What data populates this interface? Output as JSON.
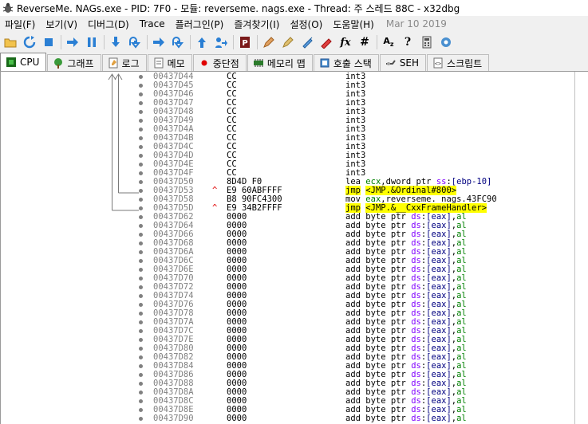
{
  "window": {
    "title": "ReverseMe. NAGs.exe - PID: 7F0 - 모듈: reverseme. nags.exe - Thread: 주 스레드 88C - x32dbg"
  },
  "menu": {
    "items": [
      "파일(F)",
      "보기(V)",
      "디버그(D)",
      "Trace",
      "플러그인(P)",
      "즐겨찾기(I)",
      "설정(O)",
      "도움말(H)"
    ],
    "date": "Mar 10 2019"
  },
  "toolbar": {
    "icons": [
      "open-folder-icon",
      "restart-icon",
      "stop-icon",
      "run-icon",
      "pause-icon",
      "step-into-icon",
      "step-over-icon",
      "trace-into-icon",
      "trace-over-icon",
      "execute-till-return-icon",
      "run-to-user-code-icon",
      "patch-icon",
      "comment-icon",
      "label-icon",
      "bookmark-icon",
      "function-icon",
      "fx-icon",
      "hash-icon",
      "font-size-icon",
      "help-icon",
      "calculator-icon",
      "settings-icon"
    ]
  },
  "tabs": [
    {
      "label": "CPU",
      "icon": "cpu-icon",
      "active": true
    },
    {
      "label": "그래프",
      "icon": "graph-icon",
      "active": false
    },
    {
      "label": "로그",
      "icon": "log-icon",
      "active": false
    },
    {
      "label": "메모",
      "icon": "notes-icon",
      "active": false
    },
    {
      "label": "중단점",
      "icon": "breakpoint-icon",
      "active": false
    },
    {
      "label": "메모리 맵",
      "icon": "memory-map-icon",
      "active": false
    },
    {
      "label": "호출 스택",
      "icon": "call-stack-icon",
      "active": false
    },
    {
      "label": "SEH",
      "icon": "seh-icon",
      "active": false
    },
    {
      "label": "스크립트",
      "icon": "script-icon",
      "active": false
    }
  ],
  "disasm": [
    {
      "addr": "00437D44",
      "arrow": "",
      "bytes": "CC",
      "dis": [
        {
          "t": "int3",
          "c": "plain"
        }
      ]
    },
    {
      "addr": "00437D45",
      "arrow": "",
      "bytes": "CC",
      "dis": [
        {
          "t": "int3",
          "c": "plain"
        }
      ]
    },
    {
      "addr": "00437D46",
      "arrow": "",
      "bytes": "CC",
      "dis": [
        {
          "t": "int3",
          "c": "plain"
        }
      ]
    },
    {
      "addr": "00437D47",
      "arrow": "",
      "bytes": "CC",
      "dis": [
        {
          "t": "int3",
          "c": "plain"
        }
      ]
    },
    {
      "addr": "00437D48",
      "arrow": "",
      "bytes": "CC",
      "dis": [
        {
          "t": "int3",
          "c": "plain"
        }
      ]
    },
    {
      "addr": "00437D49",
      "arrow": "",
      "bytes": "CC",
      "dis": [
        {
          "t": "int3",
          "c": "plain"
        }
      ]
    },
    {
      "addr": "00437D4A",
      "arrow": "",
      "bytes": "CC",
      "dis": [
        {
          "t": "int3",
          "c": "plain"
        }
      ]
    },
    {
      "addr": "00437D4B",
      "arrow": "",
      "bytes": "CC",
      "dis": [
        {
          "t": "int3",
          "c": "plain"
        }
      ]
    },
    {
      "addr": "00437D4C",
      "arrow": "",
      "bytes": "CC",
      "dis": [
        {
          "t": "int3",
          "c": "plain"
        }
      ]
    },
    {
      "addr": "00437D4D",
      "arrow": "",
      "bytes": "CC",
      "dis": [
        {
          "t": "int3",
          "c": "plain"
        }
      ]
    },
    {
      "addr": "00437D4E",
      "arrow": "",
      "bytes": "CC",
      "dis": [
        {
          "t": "int3",
          "c": "plain"
        }
      ]
    },
    {
      "addr": "00437D4F",
      "arrow": "",
      "bytes": "CC",
      "dis": [
        {
          "t": "int3",
          "c": "plain"
        }
      ]
    },
    {
      "addr": "00437D50",
      "arrow": "",
      "bytes": "8D4D F0",
      "dis": [
        {
          "t": "lea ",
          "c": "plain"
        },
        {
          "t": "ecx",
          "c": "reg"
        },
        {
          "t": ",dword ptr ",
          "c": "plain"
        },
        {
          "t": "ss",
          "c": "seg"
        },
        {
          "t": ":",
          "c": "plain"
        },
        {
          "t": "[ebp-10]",
          "c": "memref"
        }
      ]
    },
    {
      "addr": "00437D53",
      "arrow": "^",
      "bytes": "E9 60ABFFFF",
      "dis": [
        {
          "t": "jmp",
          "c": "jmp"
        },
        {
          "t": " ",
          "c": "plain"
        },
        {
          "t": "<JMP.&Ordinal#800>",
          "c": "jmp"
        }
      ]
    },
    {
      "addr": "00437D58",
      "arrow": "",
      "bytes": "B8 90FC4300",
      "dis": [
        {
          "t": "mov ",
          "c": "plain"
        },
        {
          "t": "eax",
          "c": "reg"
        },
        {
          "t": ",reverseme. nags.43FC90",
          "c": "plain"
        }
      ]
    },
    {
      "addr": "00437D5D",
      "arrow": "^",
      "bytes": "E9 34B2FFFF",
      "dis": [
        {
          "t": "jmp",
          "c": "jmp"
        },
        {
          "t": " ",
          "c": "plain"
        },
        {
          "t": "<JMP.&__CxxFrameHandler>",
          "c": "jmp"
        }
      ]
    },
    {
      "addr": "00437D62",
      "arrow": "",
      "bytes": "0000",
      "dis": "ADD"
    },
    {
      "addr": "00437D64",
      "arrow": "",
      "bytes": "0000",
      "dis": "ADD"
    },
    {
      "addr": "00437D66",
      "arrow": "",
      "bytes": "0000",
      "dis": "ADD"
    },
    {
      "addr": "00437D68",
      "arrow": "",
      "bytes": "0000",
      "dis": "ADD"
    },
    {
      "addr": "00437D6A",
      "arrow": "",
      "bytes": "0000",
      "dis": "ADD"
    },
    {
      "addr": "00437D6C",
      "arrow": "",
      "bytes": "0000",
      "dis": "ADD"
    },
    {
      "addr": "00437D6E",
      "arrow": "",
      "bytes": "0000",
      "dis": "ADD"
    },
    {
      "addr": "00437D70",
      "arrow": "",
      "bytes": "0000",
      "dis": "ADD"
    },
    {
      "addr": "00437D72",
      "arrow": "",
      "bytes": "0000",
      "dis": "ADD"
    },
    {
      "addr": "00437D74",
      "arrow": "",
      "bytes": "0000",
      "dis": "ADD"
    },
    {
      "addr": "00437D76",
      "arrow": "",
      "bytes": "0000",
      "dis": "ADD"
    },
    {
      "addr": "00437D78",
      "arrow": "",
      "bytes": "0000",
      "dis": "ADD"
    },
    {
      "addr": "00437D7A",
      "arrow": "",
      "bytes": "0000",
      "dis": "ADD"
    },
    {
      "addr": "00437D7C",
      "arrow": "",
      "bytes": "0000",
      "dis": "ADD"
    },
    {
      "addr": "00437D7E",
      "arrow": "",
      "bytes": "0000",
      "dis": "ADD"
    },
    {
      "addr": "00437D80",
      "arrow": "",
      "bytes": "0000",
      "dis": "ADD"
    },
    {
      "addr": "00437D82",
      "arrow": "",
      "bytes": "0000",
      "dis": "ADD"
    },
    {
      "addr": "00437D84",
      "arrow": "",
      "bytes": "0000",
      "dis": "ADD"
    },
    {
      "addr": "00437D86",
      "arrow": "",
      "bytes": "0000",
      "dis": "ADD"
    },
    {
      "addr": "00437D88",
      "arrow": "",
      "bytes": "0000",
      "dis": "ADD"
    },
    {
      "addr": "00437D8A",
      "arrow": "",
      "bytes": "0000",
      "dis": "ADD"
    },
    {
      "addr": "00437D8C",
      "arrow": "",
      "bytes": "0000",
      "dis": "ADD"
    },
    {
      "addr": "00437D8E",
      "arrow": "",
      "bytes": "0000",
      "dis": "ADD"
    },
    {
      "addr": "00437D90",
      "arrow": "",
      "bytes": "0000",
      "dis": "ADD"
    }
  ],
  "add_instr": [
    {
      "t": "add byte ptr ",
      "c": "plain"
    },
    {
      "t": "ds",
      "c": "seg"
    },
    {
      "t": ":",
      "c": "plain"
    },
    {
      "t": "[eax]",
      "c": "memref"
    },
    {
      "t": ",",
      "c": "plain"
    },
    {
      "t": "al",
      "c": "reg"
    }
  ],
  "colors": {
    "jmp_highlight": "#ffff00",
    "address": "#808080",
    "register": "#008000",
    "segment": "#8000ff",
    "memref": "#000080",
    "arrow": "#e00000"
  }
}
